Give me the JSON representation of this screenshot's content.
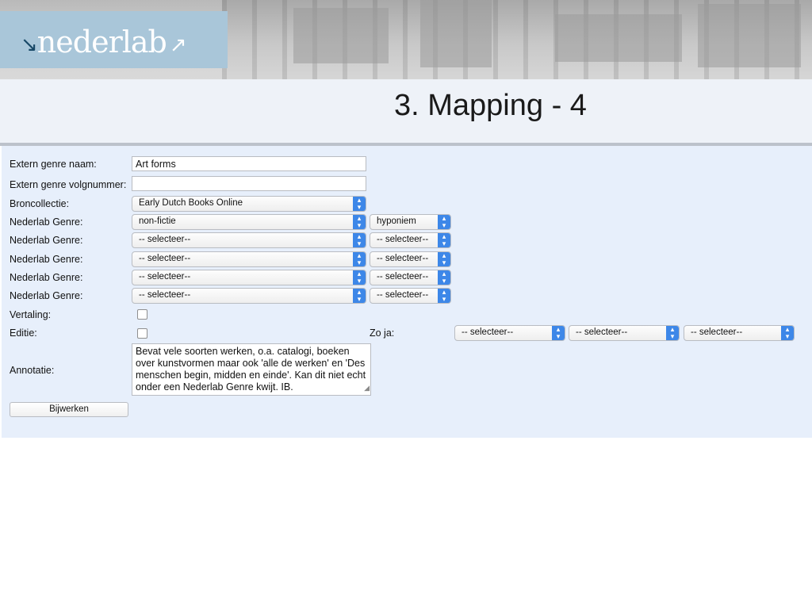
{
  "header": {
    "logo_text": "nederlab"
  },
  "slide_title": "3. Mapping - 4",
  "form": {
    "extern_genre_naam": {
      "label": "Extern genre naam:",
      "value": "Art forms"
    },
    "extern_genre_volgnummer": {
      "label": "Extern genre volgnummer:",
      "value": ""
    },
    "broncollectie": {
      "label": "Broncollectie:",
      "value": "Early Dutch Books Online"
    },
    "genre_rows": [
      {
        "label": "Nederlab Genre:",
        "genre": "non-fictie",
        "relation": "hyponiem"
      },
      {
        "label": "Nederlab Genre:",
        "genre": "-- selecteer--",
        "relation": "-- selecteer--"
      },
      {
        "label": "Nederlab Genre:",
        "genre": "-- selecteer--",
        "relation": "-- selecteer--"
      },
      {
        "label": "Nederlab Genre:",
        "genre": "-- selecteer--",
        "relation": "-- selecteer--"
      },
      {
        "label": "Nederlab Genre:",
        "genre": "-- selecteer--",
        "relation": "-- selecteer--"
      }
    ],
    "vertaling": {
      "label": "Vertaling:",
      "checked": false
    },
    "editie": {
      "label": "Editie:",
      "checked": false
    },
    "zo_ja": {
      "label": "Zo ja:",
      "selects": [
        "-- selecteer--",
        "-- selecteer--",
        "-- selecteer--"
      ]
    },
    "annotatie": {
      "label": "Annotatie:",
      "value": "Bevat vele soorten werken, o.a. catalogi, boeken over kunstvormen maar ook 'alle de werken' en 'Des menschen begin, midden en einde'. Kan dit niet echt onder een Nederlab Genre kwijt. IB."
    },
    "submit_label": "Bijwerken"
  },
  "colors": {
    "logo_box": "#a9c6d9",
    "form_panel": "#e7effb",
    "title_band": "#eef2f8",
    "select_chevron": "#3d87e8"
  }
}
